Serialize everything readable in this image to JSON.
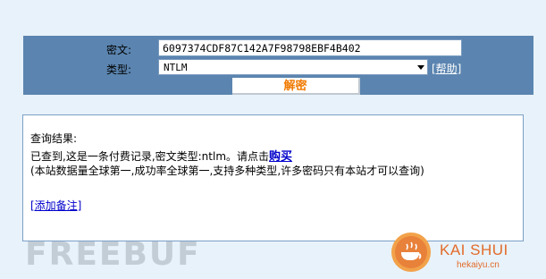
{
  "form": {
    "cipher_label": "密文:",
    "cipher_value": "6097374CDF87C142A7F98798EBF4B402",
    "type_label": "类型:",
    "type_value": "NTLM",
    "help_link": "[帮助]",
    "decrypt_button": "解密"
  },
  "result": {
    "heading": "查询结果:",
    "found_text": "已查到,这是一条付费记录,密文类型:ntlm。请点击",
    "buy_link": "购买",
    "note": "(本站数据量全球第一,成功率全球第一,支持多种类型,许多密码只有本站才可以查询)",
    "remark_link": "[添加备注]"
  },
  "watermarks": {
    "freebuf": "FREEBUF",
    "kaishui_name": "KAI SHUI",
    "kaishui_url": "hekaiyu.cn"
  },
  "colors": {
    "panel": "#5b85b0",
    "background": "#e8f2fa",
    "accent": "#f07a00",
    "link": "#0000cc"
  }
}
